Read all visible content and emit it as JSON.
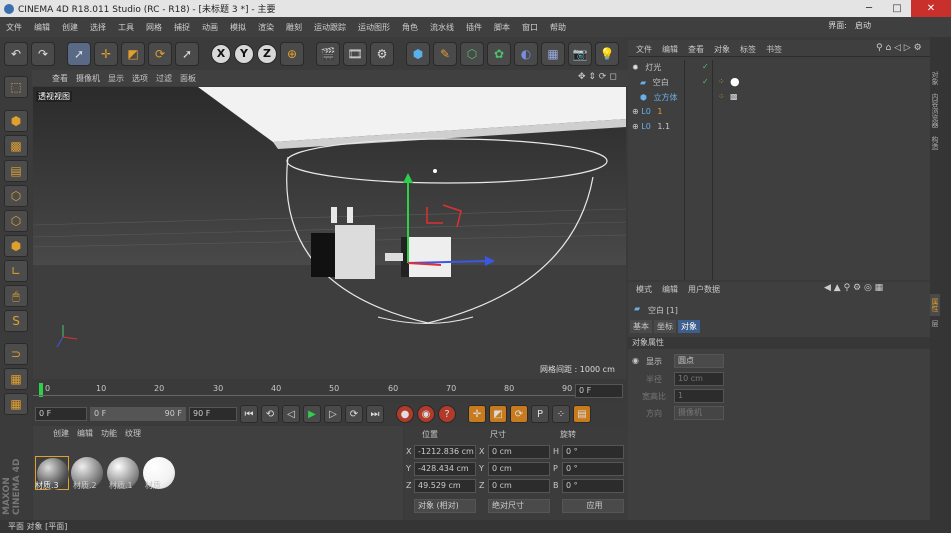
{
  "title": "CINEMA 4D R18.011 Studio (RC - R18) - [未标题 3 *] - 主要",
  "menu": [
    "文件",
    "编辑",
    "创建",
    "选择",
    "工具",
    "网格",
    "捕捉",
    "动画",
    "模拟",
    "渲染",
    "雕刻",
    "运动跟踪",
    "运动图形",
    "角色",
    "流水线",
    "插件",
    "脚本",
    "窗口",
    "帮助"
  ],
  "layout_tabs": [
    "界面:",
    "启动"
  ],
  "window_controls": {
    "minimize": "─",
    "maximize": "□",
    "close": "✕"
  },
  "toolbar": {
    "undo_icon": "undo-icon",
    "axis_x": "X",
    "axis_y": "Y",
    "axis_z": "Z"
  },
  "viewport": {
    "menu": [
      "查看",
      "摄像机",
      "显示",
      "选项",
      "过滤",
      "面板"
    ],
    "label": "透视视图",
    "grid_spacing": "网格间距 : 1000 cm"
  },
  "timeline": {
    "ticks": [
      "0",
      "10",
      "20",
      "30",
      "40",
      "50",
      "60",
      "70",
      "80",
      "90"
    ],
    "current_frame": "0 F"
  },
  "playbar": {
    "start": "0 F",
    "range_start": "0 F",
    "range_end": "90 F",
    "end": "90 F"
  },
  "materials": {
    "menu": [
      "创建",
      "编辑",
      "功能",
      "纹理"
    ],
    "items": [
      "材质.3",
      "材质.2",
      "材质.1",
      "材质"
    ]
  },
  "coords": {
    "headers": [
      "位置",
      "尺寸",
      "旋转"
    ],
    "rows": [
      {
        "axis": "X",
        "pos": "-1212.836 cm",
        "size_axis": "X",
        "size": "0 cm",
        "rot_axis": "H",
        "rot": "0 °"
      },
      {
        "axis": "Y",
        "pos": "-428.434 cm",
        "size_axis": "Y",
        "size": "0 cm",
        "rot_axis": "P",
        "rot": "0 °"
      },
      {
        "axis": "Z",
        "pos": "49.529 cm",
        "size_axis": "Z",
        "size": "0 cm",
        "rot_axis": "B",
        "rot": "0 °"
      }
    ],
    "mode_select": "对象 (相对)",
    "size_select": "绝对尺寸",
    "apply": "应用"
  },
  "object_manager": {
    "menu": [
      "文件",
      "编辑",
      "查看",
      "对象",
      "标签",
      "书签"
    ],
    "items": [
      "灯光",
      "空白",
      "立方体",
      "1",
      "1.1"
    ]
  },
  "attribute_manager": {
    "menu": [
      "模式",
      "编辑",
      "用户数据"
    ],
    "object_name": "空白 [1]",
    "tabs": [
      "基本",
      "坐标",
      "对象"
    ],
    "section": "对象属性",
    "display_label": "显示",
    "display_value": "圆点",
    "radius_label": "半径",
    "radius_value": "10 cm",
    "aspect_label": "宽高比",
    "aspect_value": "1",
    "orientation_label": "方向",
    "orientation_value": "摄像机"
  },
  "right_tabs": [
    "对象",
    "内容浏览器",
    "构造",
    "属性",
    "层"
  ],
  "status": "平面 对象 [平面]",
  "brand": "MAXON CINEMA 4D"
}
